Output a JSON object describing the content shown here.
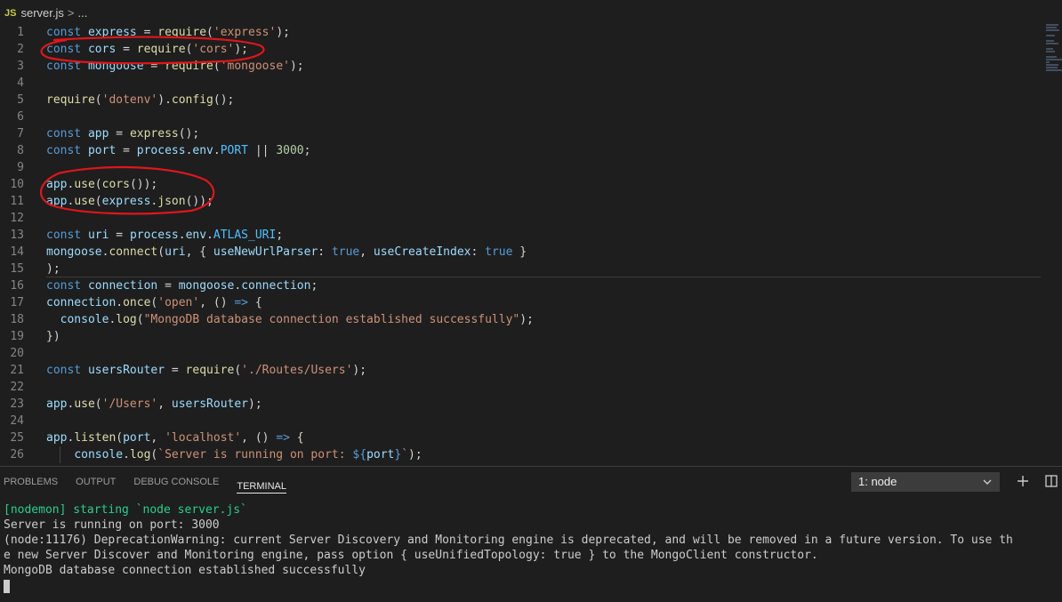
{
  "breadcrumb": {
    "file_badge": "JS",
    "file_name": "server.js",
    "separator": ">",
    "more": "..."
  },
  "editor": {
    "line_numbers": [
      "1",
      "2",
      "3",
      "4",
      "5",
      "6",
      "7",
      "8",
      "9",
      "10",
      "11",
      "12",
      "13",
      "14",
      "15",
      "16",
      "17",
      "18",
      "19",
      "20",
      "21",
      "22",
      "23",
      "24",
      "25",
      "26"
    ],
    "lines": [
      [
        [
          "k",
          "const"
        ],
        [
          "p",
          " "
        ],
        [
          "v",
          "express"
        ],
        [
          "p",
          " = "
        ],
        [
          "f",
          "require"
        ],
        [
          "p",
          "("
        ],
        [
          "s",
          "'express'"
        ],
        [
          "p",
          ");"
        ]
      ],
      [
        [
          "k",
          "const"
        ],
        [
          "p",
          " "
        ],
        [
          "v",
          "cors"
        ],
        [
          "p",
          " = "
        ],
        [
          "f",
          "require"
        ],
        [
          "p",
          "("
        ],
        [
          "s",
          "'cors'"
        ],
        [
          "p",
          ");"
        ]
      ],
      [
        [
          "k",
          "const"
        ],
        [
          "p",
          " "
        ],
        [
          "v",
          "mongoose"
        ],
        [
          "p",
          " = "
        ],
        [
          "f",
          "require"
        ],
        [
          "p",
          "("
        ],
        [
          "s",
          "'mongoose'"
        ],
        [
          "p",
          ");"
        ]
      ],
      [],
      [
        [
          "f",
          "require"
        ],
        [
          "p",
          "("
        ],
        [
          "s",
          "'dotenv'"
        ],
        [
          "p",
          ")."
        ],
        [
          "f",
          "config"
        ],
        [
          "p",
          "();"
        ]
      ],
      [],
      [
        [
          "k",
          "const"
        ],
        [
          "p",
          " "
        ],
        [
          "v",
          "app"
        ],
        [
          "p",
          " = "
        ],
        [
          "f",
          "express"
        ],
        [
          "p",
          "();"
        ]
      ],
      [
        [
          "k",
          "const"
        ],
        [
          "p",
          " "
        ],
        [
          "v",
          "port"
        ],
        [
          "p",
          " = "
        ],
        [
          "v",
          "process"
        ],
        [
          "p",
          "."
        ],
        [
          "v",
          "env"
        ],
        [
          "p",
          "."
        ],
        [
          "c",
          "PORT"
        ],
        [
          "p",
          " || "
        ],
        [
          "n",
          "3000"
        ],
        [
          "p",
          ";"
        ]
      ],
      [],
      [
        [
          "v",
          "app"
        ],
        [
          "p",
          "."
        ],
        [
          "f",
          "use"
        ],
        [
          "p",
          "("
        ],
        [
          "f",
          "cors"
        ],
        [
          "p",
          "());"
        ]
      ],
      [
        [
          "v",
          "app"
        ],
        [
          "p",
          "."
        ],
        [
          "f",
          "use"
        ],
        [
          "p",
          "("
        ],
        [
          "v",
          "express"
        ],
        [
          "p",
          "."
        ],
        [
          "f",
          "json"
        ],
        [
          "p",
          "());"
        ]
      ],
      [],
      [
        [
          "k",
          "const"
        ],
        [
          "p",
          " "
        ],
        [
          "v",
          "uri"
        ],
        [
          "p",
          " = "
        ],
        [
          "v",
          "process"
        ],
        [
          "p",
          "."
        ],
        [
          "v",
          "env"
        ],
        [
          "p",
          "."
        ],
        [
          "c",
          "ATLAS_URI"
        ],
        [
          "p",
          ";"
        ]
      ],
      [
        [
          "v",
          "mongoose"
        ],
        [
          "p",
          "."
        ],
        [
          "f",
          "connect"
        ],
        [
          "p",
          "("
        ],
        [
          "v",
          "uri"
        ],
        [
          "p",
          ", { "
        ],
        [
          "v",
          "useNewUrlParser"
        ],
        [
          "p",
          ": "
        ],
        [
          "k",
          "true"
        ],
        [
          "p",
          ", "
        ],
        [
          "v",
          "useCreateIndex"
        ],
        [
          "p",
          ": "
        ],
        [
          "k",
          "true"
        ],
        [
          "p",
          " }"
        ]
      ],
      [
        [
          "p",
          ");"
        ]
      ],
      [
        [
          "k",
          "const"
        ],
        [
          "p",
          " "
        ],
        [
          "v",
          "connection"
        ],
        [
          "p",
          " = "
        ],
        [
          "v",
          "mongoose"
        ],
        [
          "p",
          "."
        ],
        [
          "v",
          "connection"
        ],
        [
          "p",
          ";"
        ]
      ],
      [
        [
          "v",
          "connection"
        ],
        [
          "p",
          "."
        ],
        [
          "f",
          "once"
        ],
        [
          "p",
          "("
        ],
        [
          "s",
          "'open'"
        ],
        [
          "p",
          ", () "
        ],
        [
          "k",
          "=>"
        ],
        [
          "p",
          " {"
        ]
      ],
      [
        [
          "p",
          "  "
        ],
        [
          "v",
          "console"
        ],
        [
          "p",
          "."
        ],
        [
          "f",
          "log"
        ],
        [
          "p",
          "("
        ],
        [
          "s",
          "\"MongoDB database connection established successfully\""
        ],
        [
          "p",
          ");"
        ]
      ],
      [
        [
          "p",
          "})"
        ]
      ],
      [],
      [
        [
          "k",
          "const"
        ],
        [
          "p",
          " "
        ],
        [
          "v",
          "usersRouter"
        ],
        [
          "p",
          " = "
        ],
        [
          "f",
          "require"
        ],
        [
          "p",
          "("
        ],
        [
          "s",
          "'./Routes/Users'"
        ],
        [
          "p",
          ");"
        ]
      ],
      [],
      [
        [
          "v",
          "app"
        ],
        [
          "p",
          "."
        ],
        [
          "f",
          "use"
        ],
        [
          "p",
          "("
        ],
        [
          "s",
          "'/Users'"
        ],
        [
          "p",
          ", "
        ],
        [
          "v",
          "usersRouter"
        ],
        [
          "p",
          ");"
        ]
      ],
      [],
      [
        [
          "v",
          "app"
        ],
        [
          "p",
          "."
        ],
        [
          "f",
          "listen"
        ],
        [
          "p",
          "("
        ],
        [
          "v",
          "port"
        ],
        [
          "p",
          ", "
        ],
        [
          "s",
          "'localhost'"
        ],
        [
          "p",
          ", () "
        ],
        [
          "k",
          "=>"
        ],
        [
          "p",
          " {"
        ]
      ],
      [
        [
          "g",
          "    "
        ],
        [
          "v",
          "console"
        ],
        [
          "p",
          "."
        ],
        [
          "f",
          "log"
        ],
        [
          "p",
          "("
        ],
        [
          "s",
          "`Server is running on port: "
        ],
        [
          "k",
          "${"
        ],
        [
          "v",
          "port"
        ],
        [
          "k",
          "}"
        ],
        [
          "s",
          "`"
        ],
        [
          "p",
          ");"
        ]
      ]
    ]
  },
  "panel": {
    "tabs": [
      "PROBLEMS",
      "OUTPUT",
      "DEBUG CONSOLE",
      "TERMINAL"
    ],
    "active_tab": "TERMINAL",
    "terminal_select": "1: node",
    "icons": {
      "dropdown": "chevron-down-icon",
      "add": "plus-icon",
      "split": "split-terminal-icon"
    }
  },
  "terminal": {
    "lines": [
      "[nodemon] starting `node server.js`",
      "Server is running on port: 3000",
      "(node:11176) DeprecationWarning: current Server Discovery and Monitoring engine is deprecated, and will be removed in a future version. To use th",
      "e new Server Discover and Monitoring engine, pass option { useUnifiedTopology: true } to the MongoClient constructor.",
      "MongoDB database connection established successfully"
    ]
  },
  "colors": {
    "background": "#1e1e1e",
    "annotation": "#e0161a",
    "keyword": "#569cd6",
    "string": "#ce9178",
    "function": "#dcdcaa",
    "variable": "#9cdcfe",
    "nodemon": "#23d18b"
  }
}
